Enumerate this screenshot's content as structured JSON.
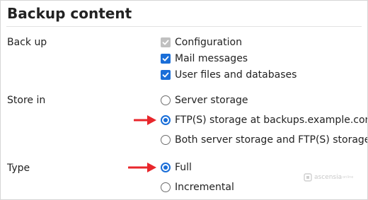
{
  "section": {
    "title": "Backup content"
  },
  "backup": {
    "label": "Back up",
    "items": [
      {
        "label": "Configuration",
        "checked": true,
        "disabled": true
      },
      {
        "label": "Mail messages",
        "checked": true,
        "disabled": false
      },
      {
        "label": "User files and databases",
        "checked": true,
        "disabled": false
      }
    ]
  },
  "store": {
    "label": "Store in",
    "options": [
      {
        "label": "Server storage",
        "selected": false
      },
      {
        "label": "FTP(S) storage at backups.example.com/",
        "selected": true
      },
      {
        "label": "Both server storage and FTP(S) storage at",
        "selected": false
      }
    ]
  },
  "type": {
    "label": "Type",
    "options": [
      {
        "label": "Full",
        "selected": true
      },
      {
        "label": "Incremental",
        "selected": false
      }
    ]
  },
  "watermark": {
    "text": "ascensia",
    "suffix": "online"
  },
  "colors": {
    "accent": "#1a6ed8",
    "arrow": "#e8262b",
    "disabled": "#c0c0c0"
  }
}
